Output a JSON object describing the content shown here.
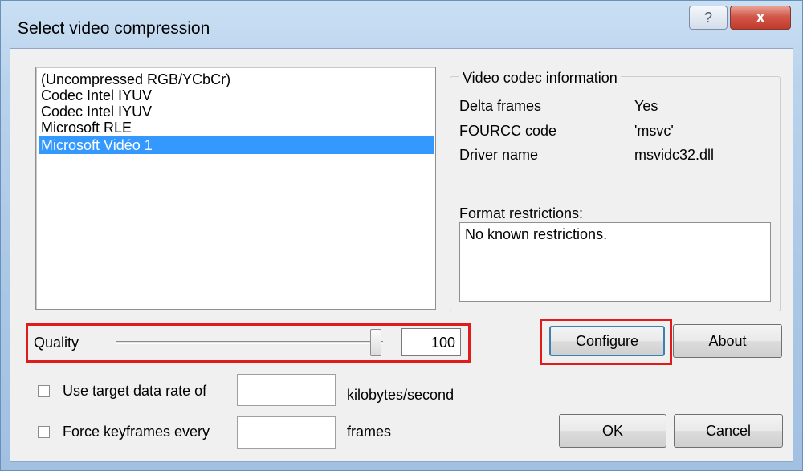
{
  "window": {
    "title": "Select video compression",
    "help_glyph": "?",
    "close_glyph": "x"
  },
  "codecs": {
    "items": [
      {
        "label": "(Uncompressed RGB/YCbCr)",
        "selected": false
      },
      {
        "label": "Codec Intel IYUV",
        "selected": false
      },
      {
        "label": "Codec Intel IYUV",
        "selected": false
      },
      {
        "label": "Microsoft RLE",
        "selected": false
      },
      {
        "label": "Microsoft Vidéo 1",
        "selected": true
      }
    ]
  },
  "codec_info": {
    "group_title": "Video codec information",
    "rows": [
      {
        "label": "Delta frames",
        "value": "Yes"
      },
      {
        "label": "FOURCC code",
        "value": "'msvc'"
      },
      {
        "label": "Driver name",
        "value": "msvidc32.dll"
      }
    ],
    "format_label": "Format restrictions:",
    "format_text": "No known restrictions."
  },
  "quality": {
    "label": "Quality",
    "value": "100",
    "slider_fraction": 1.0
  },
  "buttons": {
    "configure": "Configure",
    "about": "About",
    "ok": "OK",
    "cancel": "Cancel"
  },
  "data_rate": {
    "label": "Use target data rate of",
    "value": "",
    "unit": "kilobytes/second",
    "checked": false
  },
  "keyframes": {
    "label": "Force keyframes every",
    "value": "",
    "unit": "frames",
    "checked": false
  },
  "colors": {
    "selection": "#3399ff",
    "highlight_box": "#e01b1b",
    "title_bar": "#b9d2ec",
    "close_button": "#c23a2a"
  }
}
